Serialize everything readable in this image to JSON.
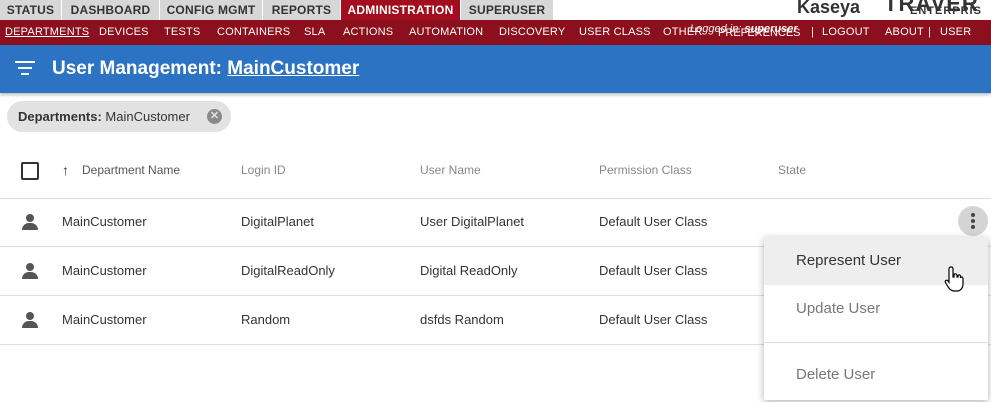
{
  "top_tabs": [
    {
      "label": "STATUS",
      "active": false
    },
    {
      "label": "DASHBOARD",
      "active": false
    },
    {
      "label": "CONFIG MGMT",
      "active": false
    },
    {
      "label": "REPORTS",
      "active": false
    },
    {
      "label": "ADMINISTRATION",
      "active": true
    },
    {
      "label": "SUPERUSER",
      "active": false
    }
  ],
  "brand": {
    "kaseya": "Kaseya",
    "traverse": "TRAVER",
    "enterprise": "ENTERPRIS"
  },
  "sub_nav": [
    {
      "label": "DEPARTMENTS",
      "active": true
    },
    {
      "label": "DEVICES"
    },
    {
      "label": "TESTS"
    },
    {
      "label": "CONTAINERS"
    },
    {
      "label": "SLA"
    },
    {
      "label": "ACTIONS"
    },
    {
      "label": "AUTOMATION"
    },
    {
      "label": "DISCOVERY"
    },
    {
      "label": "USER CLASS"
    },
    {
      "label": "OTHER"
    }
  ],
  "sub_nav_right": {
    "preferences": "PREFERENCES",
    "logged_in_prefix": "Logged in:",
    "user": "superuser",
    "logout": "LOGOUT",
    "about": "ABOUT",
    "user_guide": "USER GUI",
    "sep": "|"
  },
  "header": {
    "title_prefix": "User Management:",
    "title_link": "MainCustomer"
  },
  "chip": {
    "label": "Departments:",
    "value": "MainCustomer",
    "close_glyph": "✕"
  },
  "table": {
    "columns": [
      "Department Name",
      "Login ID",
      "User Name",
      "Permission Class",
      "State"
    ],
    "sort_glyph": "↑",
    "rows": [
      {
        "department": "MainCustomer",
        "login": "DigitalPlanet",
        "user": "User DigitalPlanet",
        "perm": "Default User Class",
        "state": ""
      },
      {
        "department": "MainCustomer",
        "login": "DigitalReadOnly",
        "user": "Digital ReadOnly",
        "perm": "Default User Class",
        "state": ""
      },
      {
        "department": "MainCustomer",
        "login": "Random",
        "user": "dsfds Random",
        "perm": "Default User Class",
        "state": ""
      }
    ]
  },
  "menu": {
    "represent": "Represent User",
    "update": "Update User",
    "delete": "Delete User"
  },
  "icons": {
    "filter": "filter-list-icon",
    "person": "person-icon",
    "more": "more-vert-icon"
  },
  "colors": {
    "admin_red": "#a30e1e",
    "nav_red": "#8b0f1c",
    "header_blue": "#2d73c3"
  }
}
